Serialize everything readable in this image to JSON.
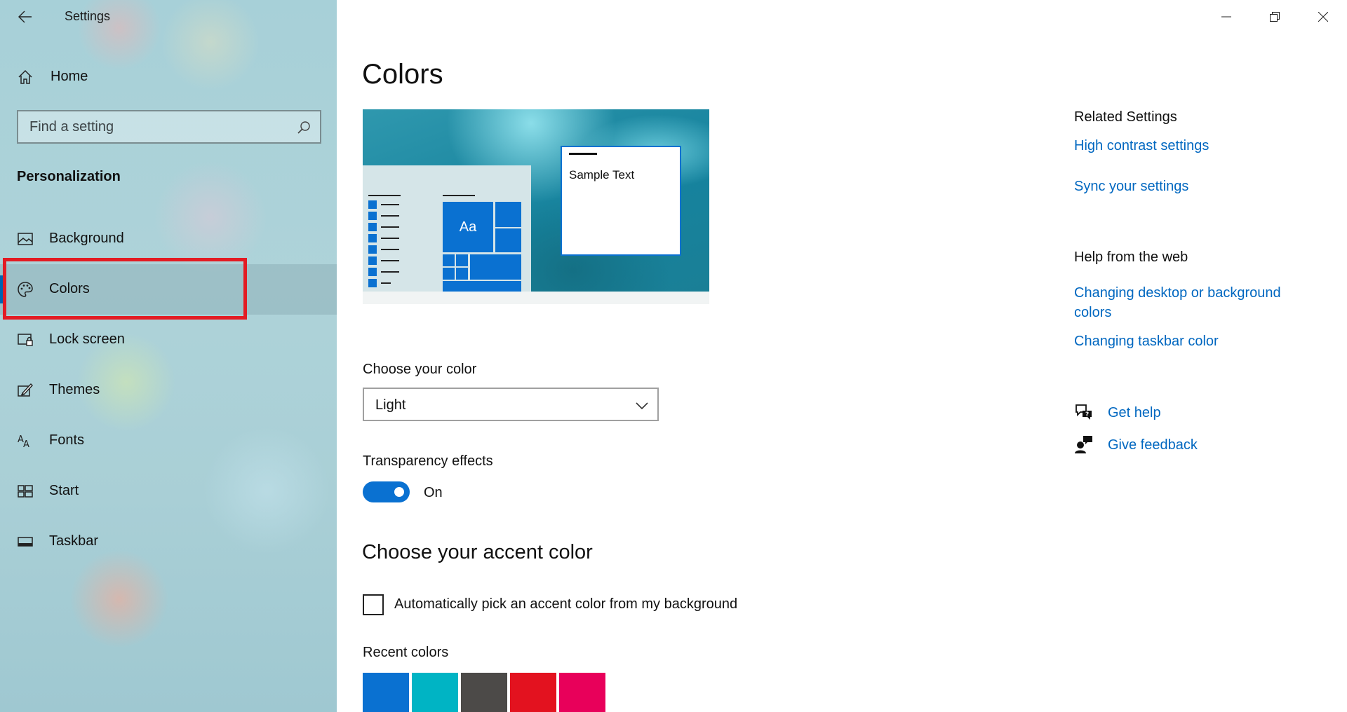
{
  "window": {
    "title": "Settings"
  },
  "sidebar": {
    "home_label": "Home",
    "search_placeholder": "Find a setting",
    "section_title": "Personalization",
    "items": [
      {
        "label": "Background",
        "icon": "picture-icon"
      },
      {
        "label": "Colors",
        "icon": "palette-icon",
        "selected": true
      },
      {
        "label": "Lock screen",
        "icon": "lock-screen-icon"
      },
      {
        "label": "Themes",
        "icon": "brush-icon"
      },
      {
        "label": "Fonts",
        "icon": "font-icon"
      },
      {
        "label": "Start",
        "icon": "start-icon"
      },
      {
        "label": "Taskbar",
        "icon": "taskbar-icon"
      }
    ]
  },
  "main": {
    "title": "Colors",
    "preview": {
      "sample_text": "Sample Text",
      "tile_text": "Aa"
    },
    "choose_color": {
      "label": "Choose your color",
      "value": "Light"
    },
    "transparency": {
      "label": "Transparency effects",
      "state_label": "On",
      "enabled": true
    },
    "accent": {
      "title": "Choose your accent color",
      "auto_pick_label": "Automatically pick an accent color from my background",
      "auto_pick_checked": false,
      "recent_label": "Recent colors",
      "recent_colors": [
        "#0a71d1",
        "#00b4c4",
        "#4c4a48",
        "#e3121f",
        "#e8005a"
      ]
    }
  },
  "related": {
    "heading": "Related Settings",
    "links": [
      "High contrast settings",
      "Sync your settings"
    ]
  },
  "help": {
    "heading": "Help from the web",
    "links": [
      "Changing desktop or background colors",
      "Changing taskbar color"
    ]
  },
  "support": {
    "get_help": "Get help",
    "give_feedback": "Give feedback"
  },
  "colors": {
    "accent": "#0a71d1",
    "link": "#0067c0",
    "highlight": "#e31b23"
  }
}
